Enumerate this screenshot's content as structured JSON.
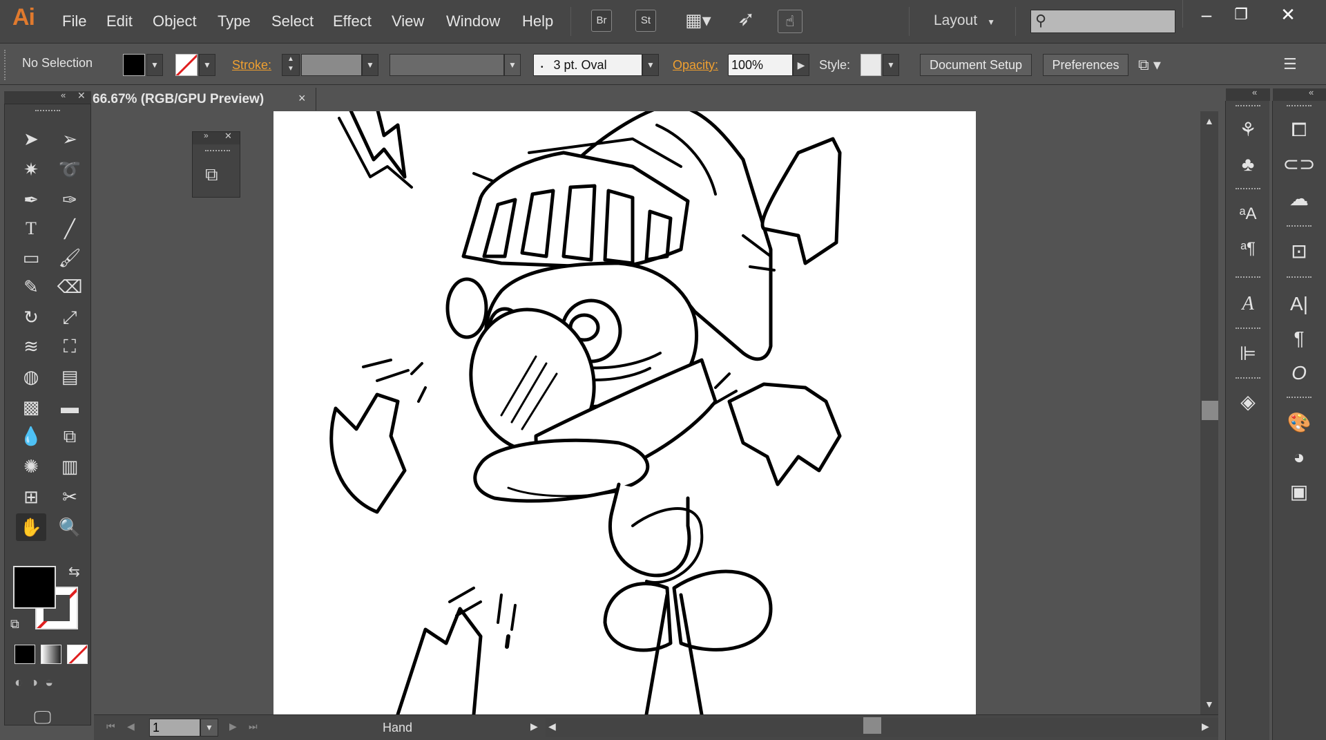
{
  "app": {
    "logo": "Ai",
    "menu": [
      "File",
      "Edit",
      "Object",
      "Type",
      "Select",
      "Effect",
      "View",
      "Window",
      "Help"
    ],
    "bridge_label": "Br",
    "stock_label": "St",
    "workspace_label": "Layout",
    "search_placeholder": ""
  },
  "control_bar": {
    "selection_status": "No Selection",
    "stroke_label": "Stroke:",
    "brush_value": "3 pt. Oval",
    "opacity_label": "Opacity:",
    "opacity_value": "100%",
    "style_label": "Style:",
    "document_setup_label": "Document Setup",
    "preferences_label": "Preferences"
  },
  "document": {
    "tab_title": "66.67% (RGB/GPU Preview)",
    "close_glyph": "×"
  },
  "status_bar": {
    "artboard_number": "1",
    "current_tool": "Hand"
  },
  "colors": {
    "chrome_dark": "#464646",
    "chrome": "#535353",
    "accent_orange": "#f0a030",
    "logo_orange": "#e07a2e",
    "fill": "#000000",
    "stroke_none_red": "#e02020"
  }
}
